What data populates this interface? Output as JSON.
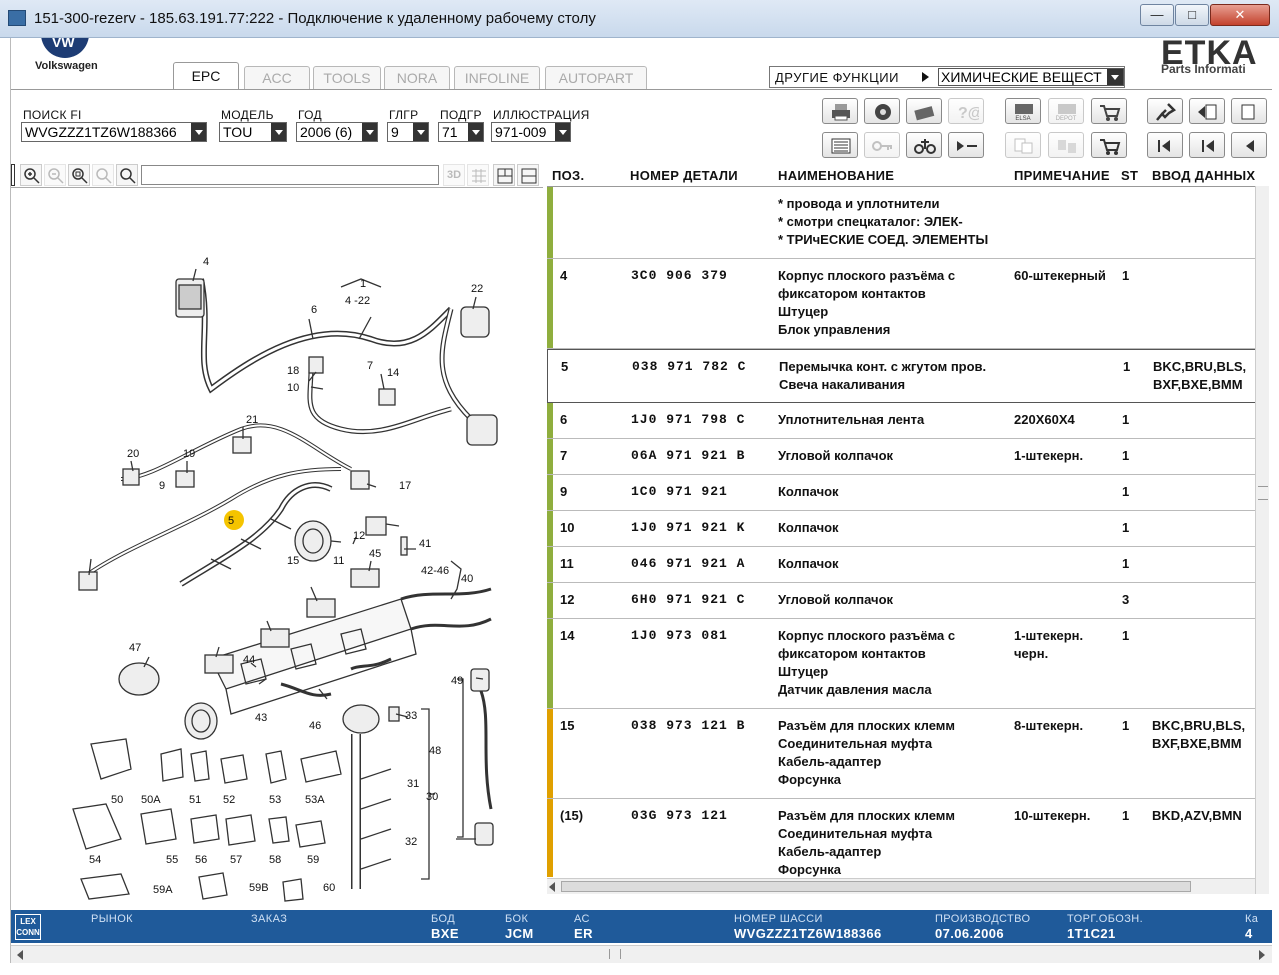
{
  "window": {
    "title": "151-300-rezerv - 185.63.191.77:222 - Подключение к удаленному рабочему столу"
  },
  "brand": {
    "vw_label": "Volkswagen",
    "etka_logo": "ETKA",
    "etka_sub": "Parts Informati"
  },
  "tabs": [
    {
      "label": "EPC",
      "active": true
    },
    {
      "label": "ACC",
      "active": false
    },
    {
      "label": "TOOLS",
      "active": false
    },
    {
      "label": "NORA",
      "active": false
    },
    {
      "label": "INFOLINE",
      "active": false
    },
    {
      "label": "AUTOPART",
      "active": false
    }
  ],
  "other_functions": {
    "label": "ДРУГИЕ ФУНКЦИИ",
    "selected": "ХИМИЧЕСКИЕ ВЕЩЕСТ"
  },
  "filters": [
    {
      "label": "ПОИСК FI",
      "value": "WVGZZZ1TZ6W188366"
    },
    {
      "label": "МОДЕЛЬ",
      "value": "TOU"
    },
    {
      "label": "ГОД",
      "value": "2006 (6)"
    },
    {
      "label": "ГЛГР",
      "value": "9"
    },
    {
      "label": "ПОДГР",
      "value": "71"
    },
    {
      "label": "ИЛЛЮСТРАЦИЯ",
      "value": "971-009"
    }
  ],
  "toolbar_captions": {
    "elsa": "ELSA",
    "depot": "DEPOT"
  },
  "illustration": {
    "highlight_color": "#f5c400",
    "callouts": [
      "4",
      "6",
      "1",
      "4 -22",
      "22",
      "18",
      "10",
      "7",
      "14",
      "21",
      "20",
      "9",
      "19",
      "5",
      "17",
      "12",
      "11",
      "15",
      "41",
      "42-46",
      "40",
      "45",
      "47",
      "44",
      "43",
      "46",
      "33",
      "49",
      "48",
      "31",
      "30",
      "32",
      "50",
      "50A",
      "51",
      "52",
      "53",
      "53A",
      "54",
      "55",
      "56",
      "57",
      "58",
      "59",
      "59A",
      "59B",
      "60"
    ]
  },
  "table": {
    "columns": [
      "ПОЗ.",
      "НОМЕР ДЕТАЛИ",
      "НАИМЕНОВАНИЕ",
      "ПРИМЕЧАНИЕ",
      "ST",
      "ВВОД ДАННЫХ"
    ],
    "rows": [
      {
        "pos": "",
        "part": "",
        "name": "* провода и уплотнители\n* смотри спецкаталог:  ЭЛЕК-\n* ТРИчЕСКИЕ СОЕД. ЭЛЕМЕНТЫ",
        "note": "",
        "st": "",
        "data": "",
        "bar": "green"
      },
      {
        "pos": "4",
        "part": "3C0 906 379",
        "name": "Корпус плоского разъёма с\nфиксатором контактов\nШтуцер\nБлок управления",
        "note": "60-штекерный",
        "st": "1",
        "data": "",
        "bar": "green"
      },
      {
        "pos": "5",
        "part": "038 971 782 C",
        "name": "Перемычка конт. с жгутом пров.\nСвеча накаливания",
        "note": "",
        "st": "1",
        "data": "BKC,BRU,BLS,\nBXF,BXE,BMM",
        "bar": "none",
        "selected": true
      },
      {
        "pos": "6",
        "part": "1J0 971 798 C",
        "name": "Уплотнительная лента",
        "note": "220X60X4",
        "st": "1",
        "data": "",
        "bar": "green"
      },
      {
        "pos": "7",
        "part": "06A 971 921 B",
        "name": "Угловой колпачок",
        "note": "1-штекерн.",
        "st": "1",
        "data": "",
        "bar": "green"
      },
      {
        "pos": "9",
        "part": "1C0 971 921",
        "name": "Колпачок",
        "note": "",
        "st": "1",
        "data": "",
        "bar": "green"
      },
      {
        "pos": "10",
        "part": "1J0 971 921 K",
        "name": "Колпачок",
        "note": "",
        "st": "1",
        "data": "",
        "bar": "green"
      },
      {
        "pos": "11",
        "part": "046 971 921 A",
        "name": "Колпачок",
        "note": "",
        "st": "1",
        "data": "",
        "bar": "green"
      },
      {
        "pos": "12",
        "part": "6H0 971 921 C",
        "name": "Угловой колпачок",
        "note": "",
        "st": "3",
        "data": "",
        "bar": "green"
      },
      {
        "pos": "14",
        "part": "1J0 973 081",
        "name": "Корпус плоского разъёма с\nфиксатором контактов\nШтуцер\nДатчик давления масла",
        "note": "1-штекерн.\nчерн.",
        "st": "1",
        "data": "",
        "bar": "green"
      },
      {
        "pos": "15",
        "part": "038 973 121 B",
        "name": "Разъём для плоских клемм\nСоединительная муфта\nКабель-адаптер\nФорсунка",
        "note": "8-штекерн.",
        "st": "1",
        "data": "BKC,BRU,BLS,\nBXF,BXE,BMM",
        "bar": "amber"
      },
      {
        "pos": "(15)",
        "part": "03G 973 121",
        "name": "Разъём для плоских клемм\nСоединительная муфта\nКабель-адаптер\nФорсунка",
        "note": "10-штекерн.",
        "st": "1",
        "data": "BKD,AZV,BMN",
        "bar": "amber"
      }
    ]
  },
  "status": {
    "fields": [
      {
        "label": "РЫНОК",
        "value": ""
      },
      {
        "label": "ЗАКАЗ",
        "value": ""
      },
      {
        "label": "БОД",
        "value": "BXE"
      },
      {
        "label": "БОК",
        "value": "JCM"
      },
      {
        "label": "АС",
        "value": "ER"
      },
      {
        "label": "НОМЕР ШАССИ",
        "value": "WVGZZZ1TZ6W188366"
      },
      {
        "label": "ПРОИЗВОДСТВО",
        "value": "07.06.2006"
      },
      {
        "label": "ТОРГ.ОБОЗН.",
        "value": "1T1C21"
      },
      {
        "label": "Ка",
        "value": "4"
      }
    ],
    "lex_logo": "LEX CONN",
    "bar_color": "#1f5a9a"
  }
}
